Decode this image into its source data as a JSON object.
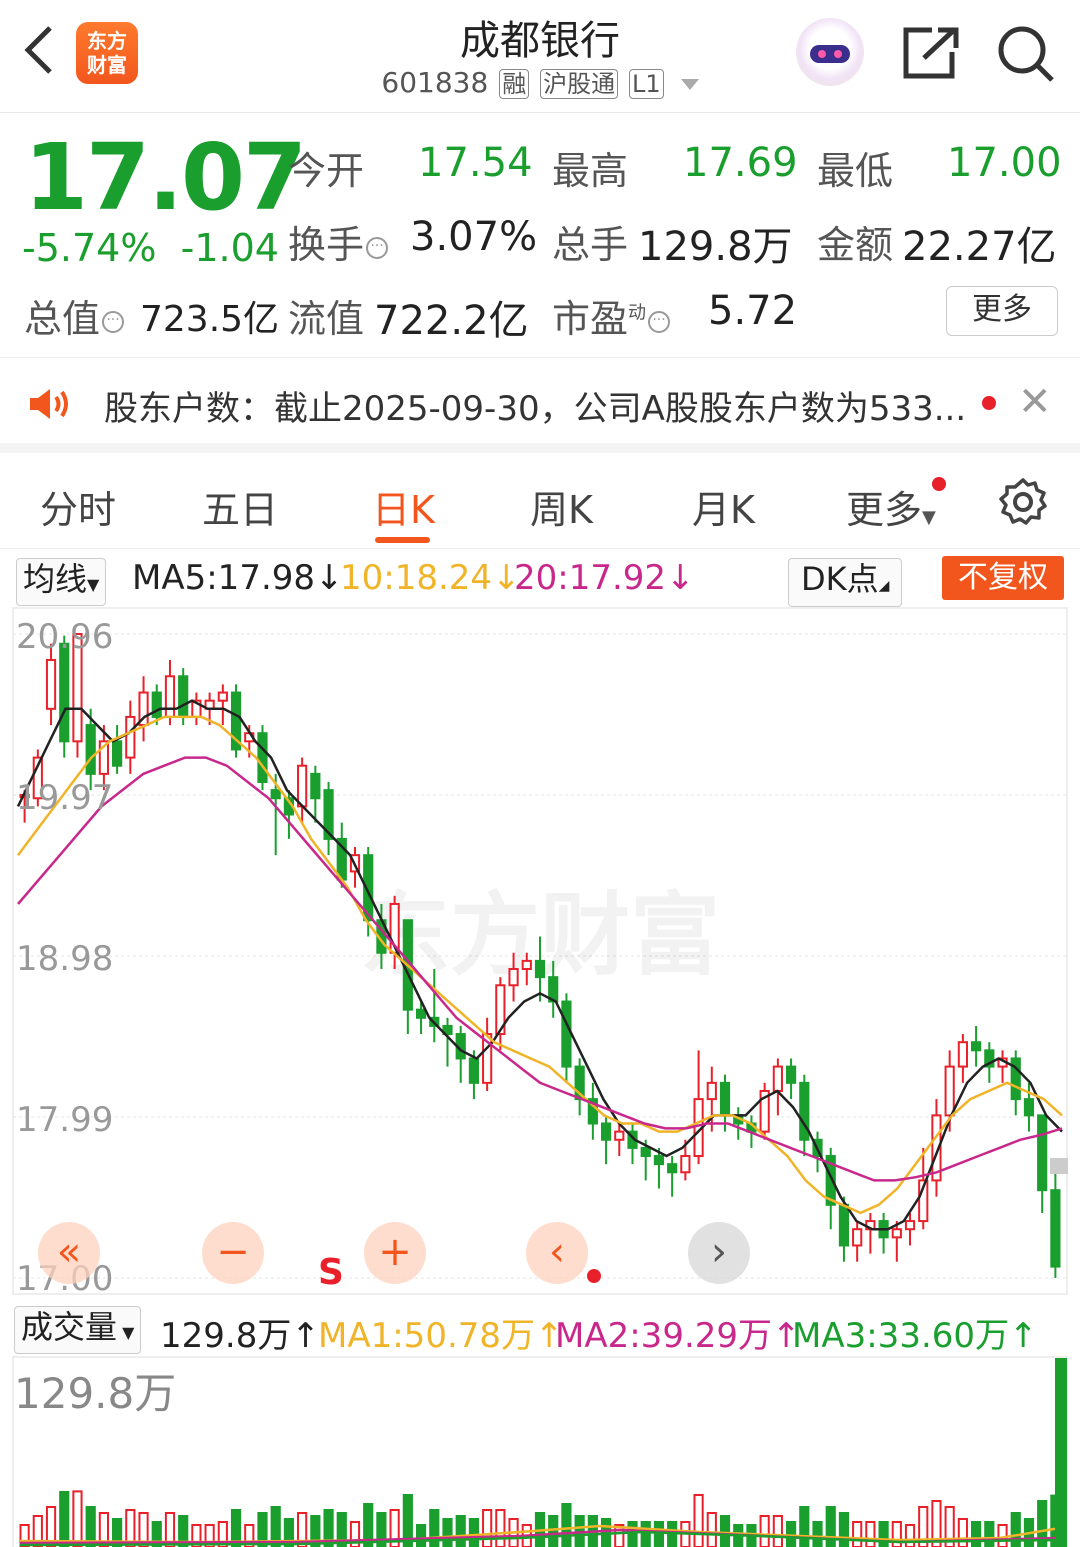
{
  "header": {
    "back_icon": "chevron-left-icon",
    "logo_text_1": "东方",
    "logo_text_2": "财富",
    "title": "成都银行",
    "code": "601838",
    "tags": [
      "融",
      "沪股通",
      "L1"
    ]
  },
  "quote": {
    "price": "17.07",
    "pct": "-5.74%",
    "change": "-1.04",
    "open_label": "今开",
    "open": "17.54",
    "high_label": "最高",
    "high": "17.69",
    "low_label": "最低",
    "low": "17.00",
    "turnover_label": "换手",
    "turnover": "3.07%",
    "volume_label": "总手",
    "volume": "129.8万",
    "amount_label": "金额",
    "amount": "22.27亿",
    "mcap_label": "总值",
    "mcap": "723.5亿",
    "float_label": "流值",
    "float": "722.2亿",
    "pe_label": "市盈",
    "pe_sup": "动",
    "pe": "5.72",
    "more": "更多",
    "colors": {
      "down": "#1a9e2e",
      "up": "#e8202a",
      "accent": "#f2561d"
    }
  },
  "notice": {
    "text": "股东户数：截止2025-09-30，公司A股股东户数为533..."
  },
  "tabs": [
    "分时",
    "五日",
    "日K",
    "周K",
    "月K",
    "更多"
  ],
  "active_tab": "日K",
  "ma_bar": {
    "selector": "均线",
    "ma5": "MA5:17.98",
    "ma10": "10:18.24",
    "ma20": "20:17.92",
    "dk": "DK点",
    "adjust": "不复权",
    "colors": {
      "ma5": "#222222",
      "ma10": "#f0b429",
      "ma20": "#c8288c"
    }
  },
  "chart_labels": {
    "y_ticks": [
      "20.96",
      "19.97",
      "18.98",
      "17.99",
      "17.00"
    ],
    "s_mark": "S",
    "watermark": "东方财富"
  },
  "controls": {
    "rewind": "«",
    "zoom_out": "−",
    "zoom_in": "+",
    "prev": "‹",
    "next": "›"
  },
  "volume_bar": {
    "selector": "成交量",
    "current": "129.8万",
    "ma1": "MA1:50.78万",
    "ma2": "MA2:39.29万",
    "ma3": "MA3:33.60万",
    "max_label": "129.8万",
    "colors": {
      "ma1": "#f0b429",
      "ma2": "#c8288c",
      "ma3": "#1a9e2e"
    }
  },
  "chart_data": {
    "type": "candlestick",
    "ylim": [
      17.0,
      20.96
    ],
    "y_ticks": [
      20.96,
      19.97,
      18.98,
      17.99,
      17.0
    ],
    "candles": [
      [
        19.97,
        19.97,
        19.8,
        20.0
      ],
      [
        19.95,
        20.2,
        19.9,
        20.25
      ],
      [
        20.5,
        20.8,
        20.4,
        20.9
      ],
      [
        20.9,
        20.3,
        20.2,
        20.95
      ],
      [
        20.3,
        20.96,
        20.2,
        20.96
      ],
      [
        20.4,
        20.1,
        20.0,
        20.5
      ],
      [
        20.1,
        20.3,
        20.0,
        20.4
      ],
      [
        20.3,
        20.15,
        20.1,
        20.4
      ],
      [
        20.2,
        20.45,
        20.1,
        20.55
      ],
      [
        20.4,
        20.6,
        20.3,
        20.7
      ],
      [
        20.6,
        20.45,
        20.4,
        20.65
      ],
      [
        20.45,
        20.7,
        20.4,
        20.8
      ],
      [
        20.7,
        20.45,
        20.4,
        20.75
      ],
      [
        20.45,
        20.55,
        20.4,
        20.6
      ],
      [
        20.5,
        20.55,
        20.4,
        20.6
      ],
      [
        20.55,
        20.6,
        20.4,
        20.65
      ],
      [
        20.6,
        20.25,
        20.2,
        20.65
      ],
      [
        20.3,
        20.35,
        20.2,
        20.4
      ],
      [
        20.35,
        20.05,
        20.0,
        20.4
      ],
      [
        20.0,
        19.95,
        19.6,
        20.1
      ],
      [
        19.95,
        19.85,
        19.7,
        20.0
      ],
      [
        19.9,
        20.15,
        19.8,
        20.2
      ],
      [
        20.1,
        19.95,
        19.8,
        20.15
      ],
      [
        20.0,
        19.7,
        19.6,
        20.05
      ],
      [
        19.7,
        19.45,
        19.4,
        19.8
      ],
      [
        19.5,
        19.6,
        19.4,
        19.65
      ],
      [
        19.6,
        19.2,
        19.1,
        19.65
      ],
      [
        19.2,
        19.0,
        18.9,
        19.3
      ],
      [
        19.0,
        19.3,
        18.9,
        19.35
      ],
      [
        19.2,
        18.65,
        18.5,
        19.2
      ],
      [
        18.65,
        18.6,
        18.5,
        18.7
      ],
      [
        18.6,
        18.55,
        18.45,
        18.9
      ],
      [
        18.55,
        18.5,
        18.3,
        18.6
      ],
      [
        18.5,
        18.35,
        18.2,
        18.55
      ],
      [
        18.35,
        18.2,
        18.1,
        18.4
      ],
      [
        18.2,
        18.5,
        18.15,
        18.6
      ],
      [
        18.5,
        18.8,
        18.4,
        18.85
      ],
      [
        18.8,
        18.9,
        18.7,
        19.0
      ],
      [
        18.9,
        18.95,
        18.8,
        19.0
      ],
      [
        18.95,
        18.85,
        18.7,
        19.1
      ],
      [
        18.85,
        18.7,
        18.6,
        18.95
      ],
      [
        18.7,
        18.3,
        18.2,
        18.75
      ],
      [
        18.3,
        18.1,
        18.0,
        18.35
      ],
      [
        18.1,
        17.95,
        17.85,
        18.2
      ],
      [
        17.95,
        17.85,
        17.7,
        18.0
      ],
      [
        17.85,
        17.9,
        17.75,
        17.95
      ],
      [
        17.9,
        17.8,
        17.7,
        17.95
      ],
      [
        17.8,
        17.75,
        17.6,
        17.85
      ],
      [
        17.75,
        17.7,
        17.55,
        17.8
      ],
      [
        17.7,
        17.65,
        17.5,
        17.75
      ],
      [
        17.65,
        17.75,
        17.6,
        17.85
      ],
      [
        17.75,
        18.1,
        17.7,
        18.4
      ],
      [
        18.1,
        18.2,
        17.9,
        18.3
      ],
      [
        18.2,
        18.0,
        17.9,
        18.25
      ],
      [
        18.0,
        17.95,
        17.85,
        18.05
      ],
      [
        17.95,
        17.9,
        17.8,
        18.0
      ],
      [
        17.9,
        18.15,
        17.85,
        18.2
      ],
      [
        18.15,
        18.3,
        18.0,
        18.35
      ],
      [
        18.3,
        18.2,
        18.1,
        18.35
      ],
      [
        18.2,
        17.85,
        17.75,
        18.25
      ],
      [
        17.85,
        17.75,
        17.65,
        17.9
      ],
      [
        17.75,
        17.45,
        17.3,
        17.8
      ],
      [
        17.45,
        17.2,
        17.1,
        17.5
      ],
      [
        17.2,
        17.3,
        17.1,
        17.35
      ],
      [
        17.3,
        17.35,
        17.15,
        17.4
      ],
      [
        17.35,
        17.25,
        17.15,
        17.4
      ],
      [
        17.25,
        17.3,
        17.1,
        17.35
      ],
      [
        17.3,
        17.35,
        17.2,
        17.4
      ],
      [
        17.35,
        17.6,
        17.3,
        17.8
      ],
      [
        17.6,
        18.0,
        17.5,
        18.1
      ],
      [
        18.0,
        18.3,
        17.9,
        18.4
      ],
      [
        18.3,
        18.45,
        18.2,
        18.5
      ],
      [
        18.45,
        18.4,
        18.3,
        18.55
      ],
      [
        18.4,
        18.3,
        18.2,
        18.45
      ],
      [
        18.3,
        18.35,
        18.2,
        18.4
      ],
      [
        18.35,
        18.1,
        18.0,
        18.4
      ],
      [
        18.1,
        18.0,
        17.9,
        18.2
      ],
      [
        18.0,
        17.54,
        17.4,
        18.0
      ],
      [
        17.54,
        17.07,
        17.0,
        17.69
      ]
    ],
    "series": [
      {
        "name": "MA5",
        "values": [
          19.9,
          20.1,
          20.3,
          20.5,
          20.5,
          20.4,
          20.3,
          20.35,
          20.45,
          20.5,
          20.5,
          20.55,
          20.5,
          20.5,
          20.45,
          20.3,
          20.2,
          20.0,
          19.9,
          19.8,
          19.7,
          19.6,
          19.4,
          19.2,
          19.0,
          18.8,
          18.6,
          18.5,
          18.4,
          18.35,
          18.45,
          18.6,
          18.7,
          18.75,
          18.7,
          18.5,
          18.3,
          18.1,
          17.95,
          17.85,
          17.8,
          17.75,
          17.8,
          17.9,
          18.0,
          18.0,
          18.0,
          18.1,
          18.15,
          18.05,
          17.9,
          17.7,
          17.5,
          17.35,
          17.3,
          17.3,
          17.35,
          17.5,
          17.75,
          18.0,
          18.2,
          18.3,
          18.35,
          18.3,
          18.2,
          18.0,
          17.9
        ]
      },
      {
        "name": "MA10",
        "values": [
          19.6,
          19.75,
          19.9,
          20.05,
          20.2,
          20.3,
          20.35,
          20.4,
          20.45,
          20.45,
          20.45,
          20.4,
          20.3,
          20.2,
          20.05,
          19.9,
          19.7,
          19.55,
          19.4,
          19.2,
          19.05,
          18.95,
          18.85,
          18.75,
          18.65,
          18.55,
          18.45,
          18.4,
          18.35,
          18.3,
          18.2,
          18.1,
          18.0,
          17.95,
          17.95,
          17.9,
          17.9,
          17.95,
          18.0,
          18.0,
          17.95,
          17.85,
          17.75,
          17.6,
          17.5,
          17.45,
          17.4,
          17.45,
          17.55,
          17.7,
          17.85,
          18.0,
          18.1,
          18.15,
          18.2,
          18.15,
          18.1,
          18.0
        ]
      },
      {
        "name": "MA20",
        "values": [
          19.3,
          19.45,
          19.6,
          19.75,
          19.9,
          20.0,
          20.1,
          20.15,
          20.2,
          20.2,
          20.15,
          20.05,
          19.95,
          19.8,
          19.65,
          19.5,
          19.35,
          19.2,
          19.05,
          18.9,
          18.75,
          18.6,
          18.5,
          18.4,
          18.3,
          18.2,
          18.15,
          18.1,
          18.05,
          18.0,
          17.95,
          17.92,
          17.92,
          17.95,
          17.95,
          17.9,
          17.85,
          17.8,
          17.75,
          17.7,
          17.65,
          17.6,
          17.6,
          17.62,
          17.65,
          17.7,
          17.75,
          17.8,
          17.85,
          17.88,
          17.92
        ]
      }
    ]
  }
}
